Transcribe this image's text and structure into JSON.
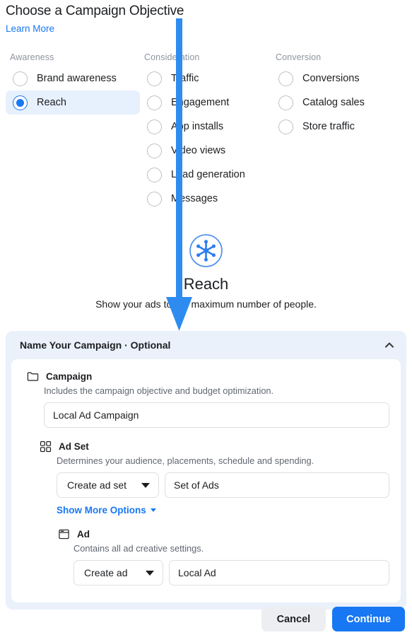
{
  "header": {
    "title": "Choose a Campaign Objective",
    "learn_more": "Learn More"
  },
  "objectives": {
    "columns": [
      {
        "heading": "Awareness",
        "options": [
          {
            "label": "Brand awareness",
            "selected": false
          },
          {
            "label": "Reach",
            "selected": true
          }
        ]
      },
      {
        "heading": "Consideration",
        "options": [
          {
            "label": "Traffic",
            "selected": false
          },
          {
            "label": "Engagement",
            "selected": false
          },
          {
            "label": "App installs",
            "selected": false
          },
          {
            "label": "Video views",
            "selected": false
          },
          {
            "label": "Lead generation",
            "selected": false
          },
          {
            "label": "Messages",
            "selected": false
          }
        ]
      },
      {
        "heading": "Conversion",
        "options": [
          {
            "label": "Conversions",
            "selected": false
          },
          {
            "label": "Catalog sales",
            "selected": false
          },
          {
            "label": "Store traffic",
            "selected": false
          }
        ]
      }
    ]
  },
  "detail": {
    "icon": "reach-spokes-icon",
    "title": "Reach",
    "description": "Show your ads to the maximum number of people."
  },
  "panel": {
    "title": "Name Your Campaign · Optional",
    "collapse_icon": "chevron-up-icon",
    "sections": [
      {
        "icon": "folder-icon",
        "title": "Campaign",
        "description": "Includes the campaign objective and budget optimization.",
        "name_value": "Local Ad Campaign"
      },
      {
        "icon": "grid-icon",
        "title": "Ad Set",
        "description": "Determines your audience, placements, schedule and spending.",
        "select_value": "Create ad set",
        "name_value": "Set of Ads",
        "more_options_label": "Show More Options"
      },
      {
        "icon": "window-icon",
        "title": "Ad",
        "description": "Contains all ad creative settings.",
        "select_value": "Create ad",
        "name_value": "Local Ad"
      }
    ]
  },
  "footer": {
    "cancel_label": "Cancel",
    "continue_label": "Continue"
  },
  "annotation": {
    "arrow_color": "#2e8cf0",
    "arrow_name": "pointer-arrow"
  },
  "colors": {
    "accent": "#1877f2",
    "panel_bg": "#eaf1fb",
    "selected_row_bg": "#e7f0fd"
  }
}
